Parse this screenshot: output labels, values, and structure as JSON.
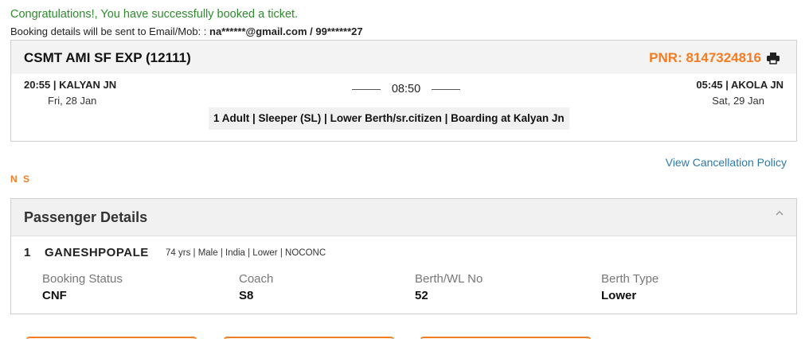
{
  "confirmation": {
    "message": "Congratulations!, You have successfully booked a ticket.",
    "details_prefix": "Booking details will be sent to Email/Mob: : ",
    "email_masked": "na******@gmail.com",
    "separator": " / ",
    "mobile_masked": "99******27"
  },
  "ticket": {
    "train_name": "CSMT AMI SF EXP (12111)",
    "pnr": "PNR: 8147324816",
    "from": {
      "time_station": "20:55 | KALYAN JN",
      "date": "Fri, 28 Jan"
    },
    "duration": "08:50",
    "to": {
      "time_station": "05:45 | AKOLA JN",
      "date": "Sat, 29 Jan"
    },
    "class_info": "1 Adult | Sleeper (SL) | Lower Berth/sr.citizen | Boarding at Kalyan Jn",
    "icons": {
      "print": "print-icon"
    }
  },
  "links": {
    "cancellation_policy": "View Cancellation Policy"
  },
  "ns_label": "N S",
  "passengers": {
    "title": "Passenger Details",
    "collapse_icon": "chevron-up-icon",
    "labels": {
      "booking_status": "Booking Status",
      "coach": "Coach",
      "berth": "Berth/WL No",
      "berth_type": "Berth Type"
    },
    "items": [
      {
        "number": "1",
        "name": "GANESHPOPALE",
        "meta": "74 yrs | Male | India | Lower | NOCONC",
        "booking_status": "CNF",
        "coach": "S8",
        "berth": "52",
        "berth_type": "Lower"
      }
    ]
  },
  "colors": {
    "accent": "#f57c20",
    "success": "#2e8b2e",
    "link": "#2a7ab0"
  }
}
